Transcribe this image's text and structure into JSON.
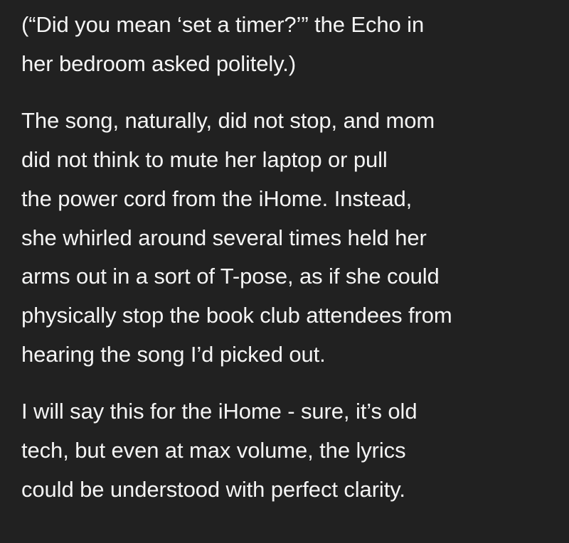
{
  "post": {
    "paragraphs": [
      {
        "lines": [
          "(“Did you mean ‘set a timer?’” the Echo in",
          "her bedroom asked politely.)"
        ]
      },
      {
        "lines": [
          "The song, naturally, did not stop, and mom",
          "did not think to mute her laptop or pull",
          "the power cord from the iHome. Instead,",
          "she whirled around several times held her",
          "arms out in a sort of T-pose, as if she could",
          "physically stop the book club attendees from",
          "hearing the song I’d picked out."
        ]
      },
      {
        "lines": [
          "I will say this for the iHome - sure, it’s old",
          "tech, but even at max volume, the lyrics",
          "could be understood with perfect clarity."
        ]
      }
    ]
  }
}
